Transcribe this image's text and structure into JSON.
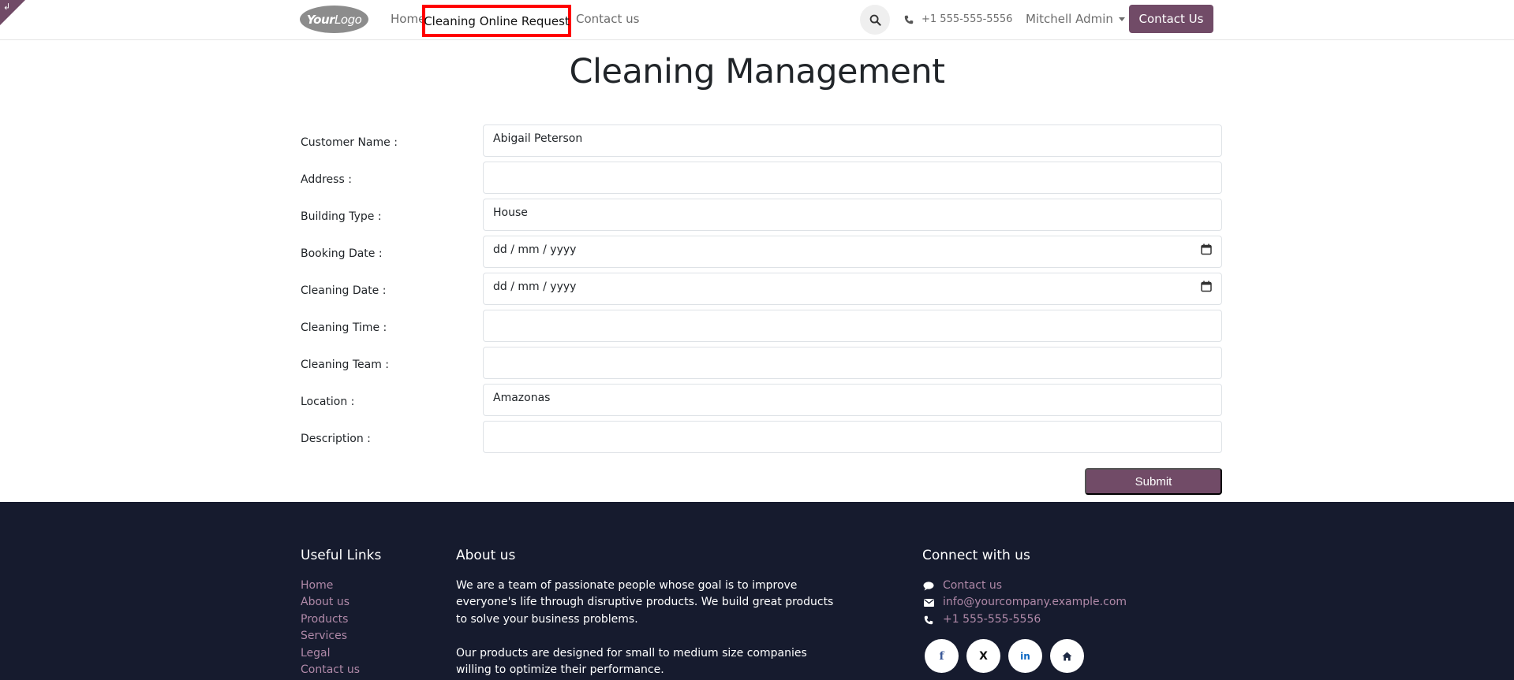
{
  "header": {
    "logo_text_bold": "Your",
    "logo_text": "Logo",
    "nav": {
      "home": "Home",
      "cleaning_request": "Cleaning Online Request",
      "contact": "Contact us"
    },
    "phone": "+1 555-555-5556",
    "user": "Mitchell Admin",
    "cta": "Contact Us"
  },
  "page": {
    "title": "Cleaning Management"
  },
  "form": {
    "fields": [
      {
        "label": "Customer Name :",
        "value": "Abigail Peterson"
      },
      {
        "label": "Address :",
        "value": ""
      },
      {
        "label": "Building Type :",
        "value": "House"
      },
      {
        "label": "Booking Date :",
        "value": "dd / mm / yyyy"
      },
      {
        "label": "Cleaning Date :",
        "value": "dd / mm / yyyy"
      },
      {
        "label": "Cleaning Time :",
        "value": ""
      },
      {
        "label": "Cleaning Team :",
        "value": ""
      },
      {
        "label": "Location :",
        "value": "Amazonas"
      },
      {
        "label": "Description :",
        "value": ""
      }
    ],
    "submit": "Submit"
  },
  "footer": {
    "useful_links": {
      "title": "Useful Links",
      "items": [
        "Home",
        "About us",
        "Products",
        "Services",
        "Legal",
        "Contact us"
      ]
    },
    "about": {
      "title": "About us",
      "p1": "We are a team of passionate people whose goal is to improve everyone's life through disruptive products. We build great products to solve your business problems.",
      "p2": "Our products are designed for small to medium size companies willing to optimize their performance."
    },
    "connect": {
      "title": "Connect with us",
      "contact": "Contact us",
      "email": "info@yourcompany.example.com",
      "phone": "+1 555-555-5556"
    },
    "social": {
      "facebook": "f",
      "x": "X",
      "linkedin": "in"
    }
  },
  "colors": {
    "brand": "#714b67",
    "highlight": "#ff0000",
    "footer_bg": "#161b2e",
    "footer_link": "#b089a8"
  }
}
